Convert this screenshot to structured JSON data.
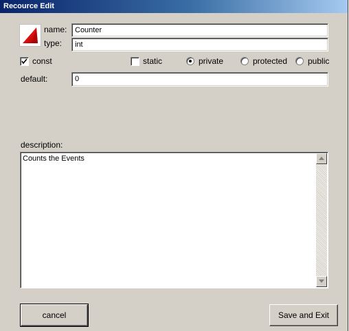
{
  "window": {
    "title": "Recource Edit"
  },
  "fields": {
    "name_label": "name:",
    "name_value": "Counter",
    "type_label": "type:",
    "type_value": "int",
    "default_label": "default:",
    "default_value": "0",
    "description_label": "description:",
    "description_value": "Counts the Events"
  },
  "modifiers": {
    "const": {
      "label": "const",
      "checked": true
    },
    "static": {
      "label": "static",
      "checked": false
    }
  },
  "visibility": {
    "options": [
      "private",
      "protected",
      "public"
    ],
    "selected": "private"
  },
  "buttons": {
    "cancel": "cancel",
    "save": "Save and Exit"
  },
  "icons": {
    "resource": "red-triangle-icon",
    "scroll_up": "scroll-up-arrow-icon",
    "scroll_down": "scroll-down-arrow-icon",
    "check": "checkmark-icon"
  },
  "colors": {
    "titlebar_start": "#0a246a",
    "titlebar_end": "#a6caf0",
    "dialog_bg": "#d4d0c8",
    "icon_red": "#e01010"
  }
}
